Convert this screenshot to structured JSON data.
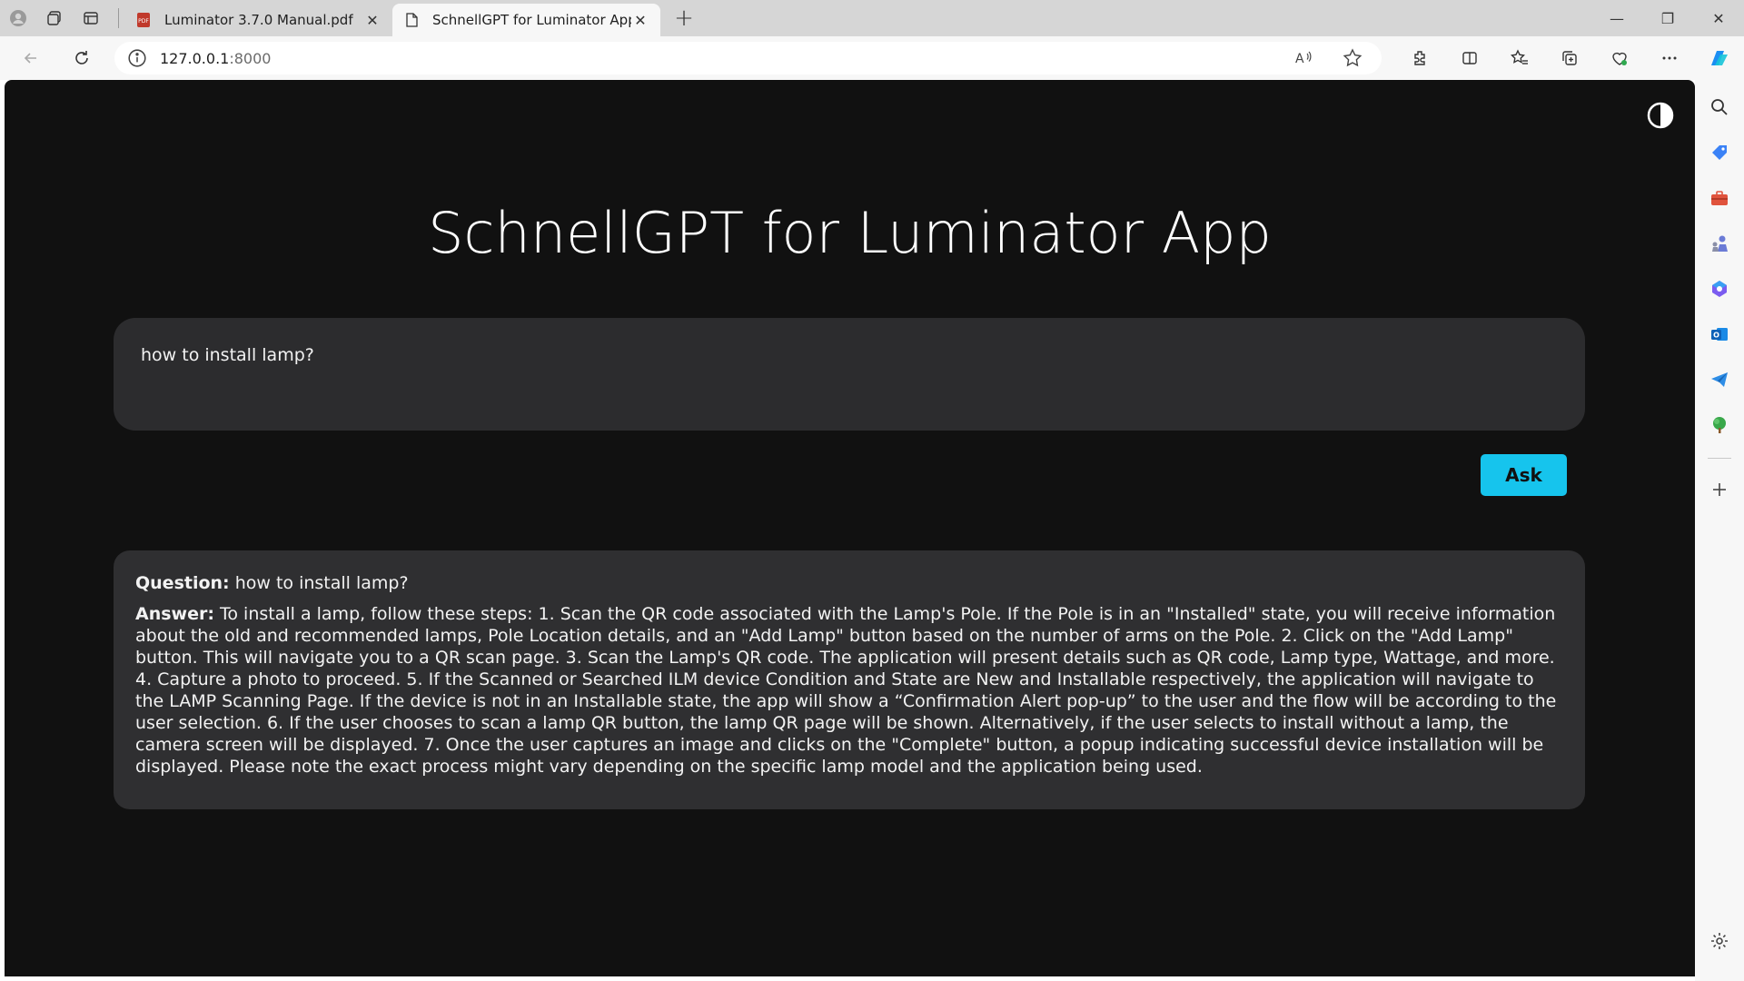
{
  "browser": {
    "tabs": [
      {
        "label": "Luminator 3.7.0 Manual.pdf",
        "favicon": "pdf-icon",
        "active": false
      },
      {
        "label": "SchnellGPT for Luminator App",
        "favicon": "page-icon",
        "active": true
      }
    ],
    "address": {
      "host": "127.0.0.1",
      "port": ":8000"
    }
  },
  "page": {
    "title": "SchnellGPT for Luminator App",
    "question_input": "how to install lamp?",
    "ask_label": "Ask",
    "result": {
      "question_label": "Question:",
      "question_text": "how to install lamp?",
      "answer_label": "Answer:",
      "answer_text": "To install a lamp, follow these steps: 1. Scan the QR code associated with the Lamp's Pole. If the Pole is in an \"Installed\" state, you will receive information about the old and recommended lamps, Pole Location details, and an \"Add Lamp\" button based on the number of arms on the Pole. 2. Click on the \"Add Lamp\" button. This will navigate you to a QR scan page. 3. Scan the Lamp's QR code. The application will present details such as QR code, Lamp type, Wattage, and more. 4. Capture a photo to proceed. 5. If the Scanned or Searched ILM device Condition and State are New and Installable respectively, the application will navigate to the LAMP Scanning Page. If the device is not in an Installable state, the app will show a “Confirmation Alert pop-up” to the user and the flow will be according to the user selection. 6. If the user chooses to scan a lamp QR button, the lamp QR page will be shown. Alternatively, if the user selects to install without a lamp, the camera screen will be displayed. 7. Once the user captures an image and clicks on the \"Complete\" button, a popup indicating successful device installation will be displayed. Please note the exact process might vary depending on the specific lamp model and the application being used."
    }
  },
  "colors": {
    "page_bg": "#111111",
    "box_bg": "#2c2c2e",
    "ask_button": "#16c4ed"
  }
}
